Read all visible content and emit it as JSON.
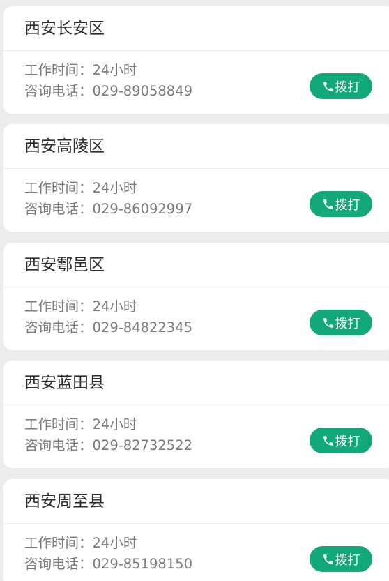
{
  "cards": [
    {
      "title": "西安长安区",
      "hours_label": "工作时间：",
      "hours": "24小时",
      "phone_label": "咨询电话：",
      "phone": "029-89058849",
      "call_label": "拨打"
    },
    {
      "title": "西安高陵区",
      "hours_label": "工作时间：",
      "hours": "24小时",
      "phone_label": "咨询电话：",
      "phone": "029-86092997",
      "call_label": "拨打"
    },
    {
      "title": "西安鄠邑区",
      "hours_label": "工作时间：",
      "hours": "24小时",
      "phone_label": "咨询电话：",
      "phone": "029-84822345",
      "call_label": "拨打"
    },
    {
      "title": "西安蓝田县",
      "hours_label": "工作时间：",
      "hours": "24小时",
      "phone_label": "咨询电话：",
      "phone": "029-82732522",
      "call_label": "拨打"
    },
    {
      "title": "西安周至县",
      "hours_label": "工作时间：",
      "hours": "24小时",
      "phone_label": "咨询电话：",
      "phone": "029-85198150",
      "call_label": "拨打"
    }
  ],
  "colors": {
    "background": "#ececec",
    "card": "#ffffff",
    "call_button": "#12a878",
    "title_text": "#2b2b2b",
    "info_text": "#7a7a7a"
  },
  "icons": {
    "call_button": "phone-icon"
  }
}
